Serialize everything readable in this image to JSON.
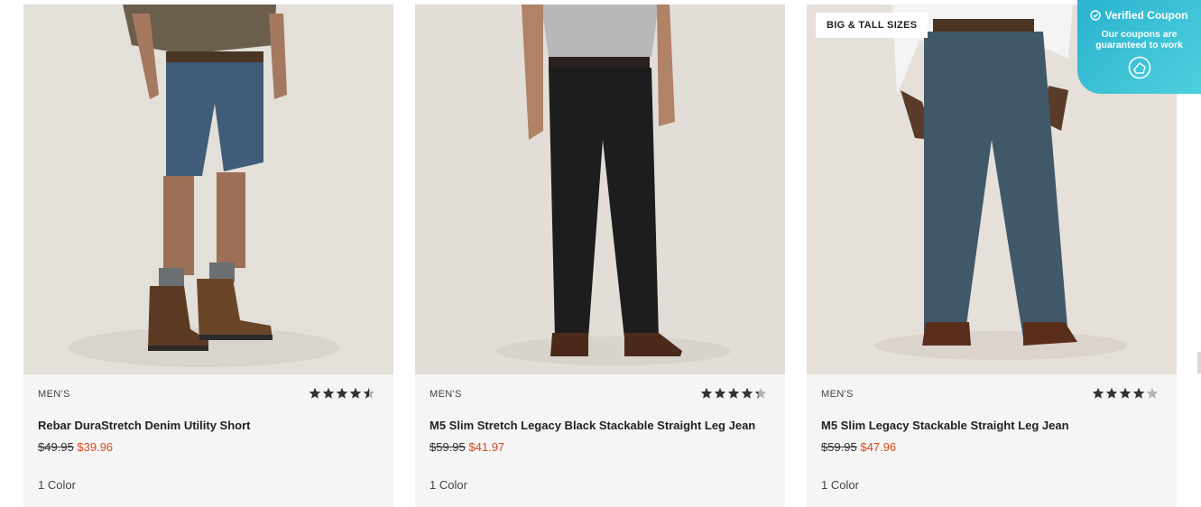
{
  "products": [
    {
      "badge": "",
      "gender": "MEN'S",
      "name": "Rebar DuraStretch Denim Utility Short",
      "was": "$49.95",
      "now": "$39.96",
      "colors": "1 Color",
      "rating": 4.5,
      "image": "denim-shorts-and-work-boots"
    },
    {
      "badge": "",
      "gender": "MEN'S",
      "name": "M5 Slim Stretch Legacy Black Stackable Straight Leg Jean",
      "was": "$59.95",
      "now": "$41.97",
      "colors": "1 Color",
      "rating": 4.3,
      "image": "black-jeans-and-boots"
    },
    {
      "badge": "BIG & TALL SIZES",
      "gender": "MEN'S",
      "name": "M5 Slim Legacy Stackable Straight Leg Jean",
      "was": "$59.95",
      "now": "$47.96",
      "colors": "1 Color",
      "rating": 4.0,
      "image": "blue-jeans-and-boots"
    }
  ],
  "coupon": {
    "title": "Verified Coupon",
    "subtitle_line1": "Our coupons are",
    "subtitle_line2": "guaranteed to work"
  },
  "colors": {
    "sale": "#d84a1b",
    "star": "#333333",
    "coupon": "#2ab3cf"
  }
}
